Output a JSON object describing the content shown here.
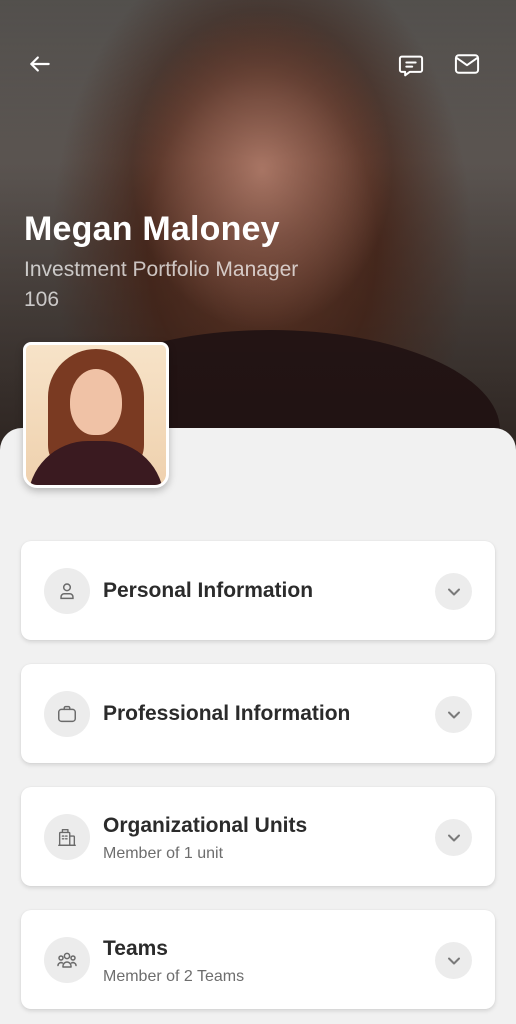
{
  "header": {
    "back_icon": "arrow-left-icon",
    "chat_icon": "chat-icon",
    "mail_icon": "mail-icon"
  },
  "profile": {
    "name": "Megan Maloney",
    "title": "Investment Portfolio Manager",
    "extension": "106"
  },
  "sections": {
    "personal": {
      "title": "Personal Information",
      "icon": "person-icon"
    },
    "professional": {
      "title": "Professional Information",
      "icon": "briefcase-icon"
    },
    "org_units": {
      "title": "Organizational Units",
      "subtitle": "Member of 1 unit",
      "icon": "building-icon"
    },
    "teams": {
      "title": "Teams",
      "subtitle": "Member of 2 Teams",
      "icon": "team-icon"
    }
  },
  "colors": {
    "background": "#f1f1f1",
    "card": "#ffffff",
    "icon_circle": "#ececec",
    "title_text": "#2b2b2b",
    "subtitle_text": "#6d6d6d"
  }
}
